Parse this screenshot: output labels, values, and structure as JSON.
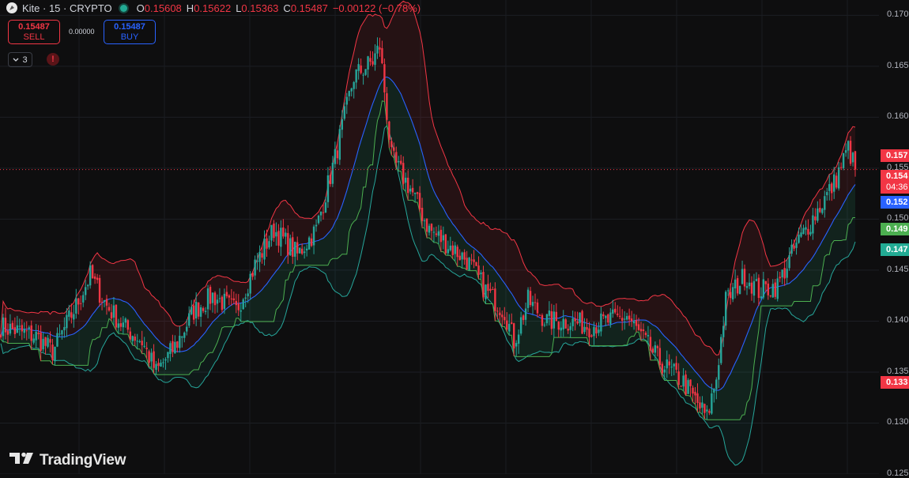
{
  "header": {
    "symbol": "Kite · 15 · CRYPTO",
    "open_key": "O",
    "open": "0.15608",
    "high_key": "H",
    "high": "0.15622",
    "low_key": "L",
    "low": "0.15363",
    "close_key": "C",
    "close": "0.15487",
    "change": "−0.00122 (−0.78%)"
  },
  "trade": {
    "sell_price": "0.15487",
    "sell_label": "SELL",
    "spread": "0.00000",
    "buy_price": "0.15487",
    "buy_label": "BUY"
  },
  "indicators": {
    "count": "3",
    "warning": "!"
  },
  "brand": {
    "name": "TradingView"
  },
  "axis": {
    "ticks": [
      "0.170",
      "0.165",
      "0.160",
      "0.155",
      "0.150",
      "0.145",
      "0.140",
      "0.135",
      "0.130",
      "0.125"
    ]
  },
  "price_tags": {
    "upper": "0.157",
    "current": "0.154",
    "countdown": "04:36",
    "ma": "0.152",
    "ind1": "0.149",
    "ind2": "0.147",
    "lower": "0.133"
  },
  "colors": {
    "up": "#26a69a",
    "down": "#f23645",
    "ma": "#2962ff",
    "upper_band": "#f23645",
    "lower_band": "#26a69a",
    "green_line": "#4caf50",
    "background": "#0e0e0f"
  },
  "chart_data": {
    "type": "candlestick",
    "ylim": [
      0.125,
      0.1715
    ],
    "grid": true,
    "current_price": 0.15487,
    "anchors": [
      {
        "i": 0,
        "p": 0.1395
      },
      {
        "i": 15,
        "p": 0.1385
      },
      {
        "i": 22,
        "p": 0.137
      },
      {
        "i": 32,
        "p": 0.1415
      },
      {
        "i": 38,
        "p": 0.1445
      },
      {
        "i": 45,
        "p": 0.1415
      },
      {
        "i": 52,
        "p": 0.1395
      },
      {
        "i": 60,
        "p": 0.138
      },
      {
        "i": 66,
        "p": 0.135
      },
      {
        "i": 74,
        "p": 0.1375
      },
      {
        "i": 82,
        "p": 0.141
      },
      {
        "i": 90,
        "p": 0.1425
      },
      {
        "i": 100,
        "p": 0.141
      },
      {
        "i": 108,
        "p": 0.1455
      },
      {
        "i": 116,
        "p": 0.149
      },
      {
        "i": 126,
        "p": 0.1465
      },
      {
        "i": 134,
        "p": 0.149
      },
      {
        "i": 142,
        "p": 0.156
      },
      {
        "i": 150,
        "p": 0.164
      },
      {
        "i": 158,
        "p": 0.1655
      },
      {
        "i": 161,
        "p": 0.167
      },
      {
        "i": 166,
        "p": 0.156
      },
      {
        "i": 174,
        "p": 0.153
      },
      {
        "i": 182,
        "p": 0.149
      },
      {
        "i": 190,
        "p": 0.1475
      },
      {
        "i": 198,
        "p": 0.146
      },
      {
        "i": 206,
        "p": 0.143
      },
      {
        "i": 214,
        "p": 0.141
      },
      {
        "i": 218,
        "p": 0.138
      },
      {
        "i": 224,
        "p": 0.142
      },
      {
        "i": 232,
        "p": 0.14
      },
      {
        "i": 242,
        "p": 0.14
      },
      {
        "i": 250,
        "p": 0.1395
      },
      {
        "i": 258,
        "p": 0.14
      },
      {
        "i": 266,
        "p": 0.1405
      },
      {
        "i": 272,
        "p": 0.1385
      },
      {
        "i": 280,
        "p": 0.136
      },
      {
        "i": 290,
        "p": 0.134
      },
      {
        "i": 300,
        "p": 0.1305
      },
      {
        "i": 304,
        "p": 0.1345
      },
      {
        "i": 308,
        "p": 0.142
      },
      {
        "i": 316,
        "p": 0.1445
      },
      {
        "i": 322,
        "p": 0.143
      },
      {
        "i": 330,
        "p": 0.1435
      },
      {
        "i": 338,
        "p": 0.1475
      },
      {
        "i": 346,
        "p": 0.1505
      },
      {
        "i": 354,
        "p": 0.1535
      },
      {
        "i": 360,
        "p": 0.157
      },
      {
        "i": 363,
        "p": 0.1549
      }
    ],
    "candle_count": 364,
    "indicators": [
      "Bollinger Bands (20, 2)",
      "Moving Average",
      "Lowest Low Stop"
    ]
  }
}
